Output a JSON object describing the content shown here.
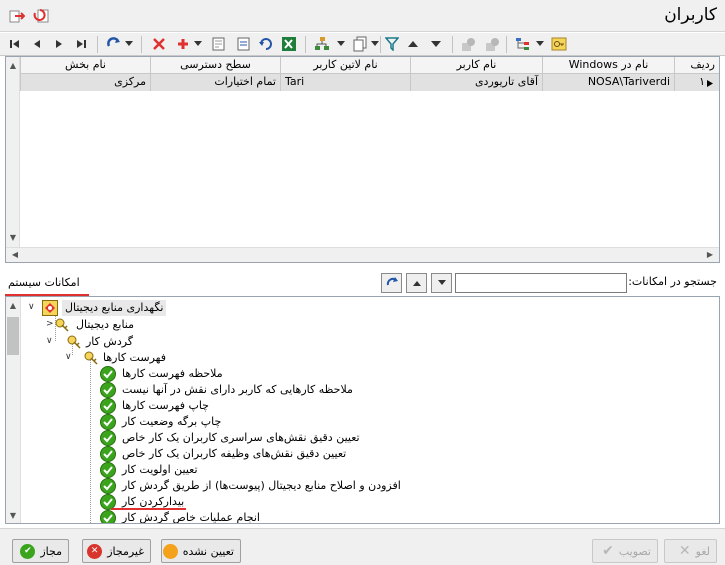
{
  "window": {
    "title": "کاربران"
  },
  "toolbar": {
    "icons": [
      "first-record",
      "prev-record",
      "next-record",
      "last-record",
      "refresh-options",
      "delete",
      "add",
      "add-options",
      "edit-record",
      "view-record",
      "reload",
      "export-excel",
      "org-chart",
      "org-chart-options",
      "copy",
      "copy-options",
      "filter",
      "move-up",
      "move-down",
      "lock-disabled",
      "unlock-disabled",
      "hierarchy",
      "hierarchy-options",
      "key-settings"
    ]
  },
  "grid": {
    "columns": [
      "ردیف",
      "نام در Windows",
      "نام کاربر",
      "نام لاتین کاربر",
      "سطح دسترسی",
      "نام بخش"
    ],
    "rows": [
      {
        "index": "۱",
        "windows": "NOSA\\Tariverdi",
        "name": "آقای تاریوردی",
        "latin": "Tari",
        "access": "تمام اختیارات",
        "dept": "مرکزی"
      }
    ]
  },
  "search": {
    "label": "جستجو در امکانات:",
    "value": "",
    "section_title": "امکانات سیستم"
  },
  "tree": {
    "root": "نگهداری منابع دیجیتال",
    "nodes": [
      "منابع دیجیتال",
      "گردش کار",
      "فهرست کارها",
      "ملاحظه فهرست کارها",
      "ملاحظه کارهایی که کاربر دارای نقش در آنها نیست",
      "چاپ فهرست کارها",
      "چاپ برگه وضعیت کار",
      "تعیین دقیق نقش‌های سراسری کاربران یک کار خاص",
      "تعیین دقیق نقش‌های وظیفه کاربران یک کار خاص",
      "تعیین اولویت کار",
      "افزودن و اصلاح منابع دیجیتال (پیوست‌ها) از طریق گردش کار",
      "بیدارکردن کار",
      "انجام عملیات خاص گردش کار"
    ]
  },
  "buttons": {
    "allowed": "مجاز",
    "denied": "غیرمجاز",
    "undetermined": "تعیین نشده",
    "approve": "تصویب",
    "cancel": "لغو"
  },
  "colors": {
    "accent_red": "#e03030",
    "check_green": "#3aa51c",
    "deny_red": "#d8342c",
    "undetermined_orange": "#f4a21c",
    "selected_row": "#e1e1e1"
  }
}
